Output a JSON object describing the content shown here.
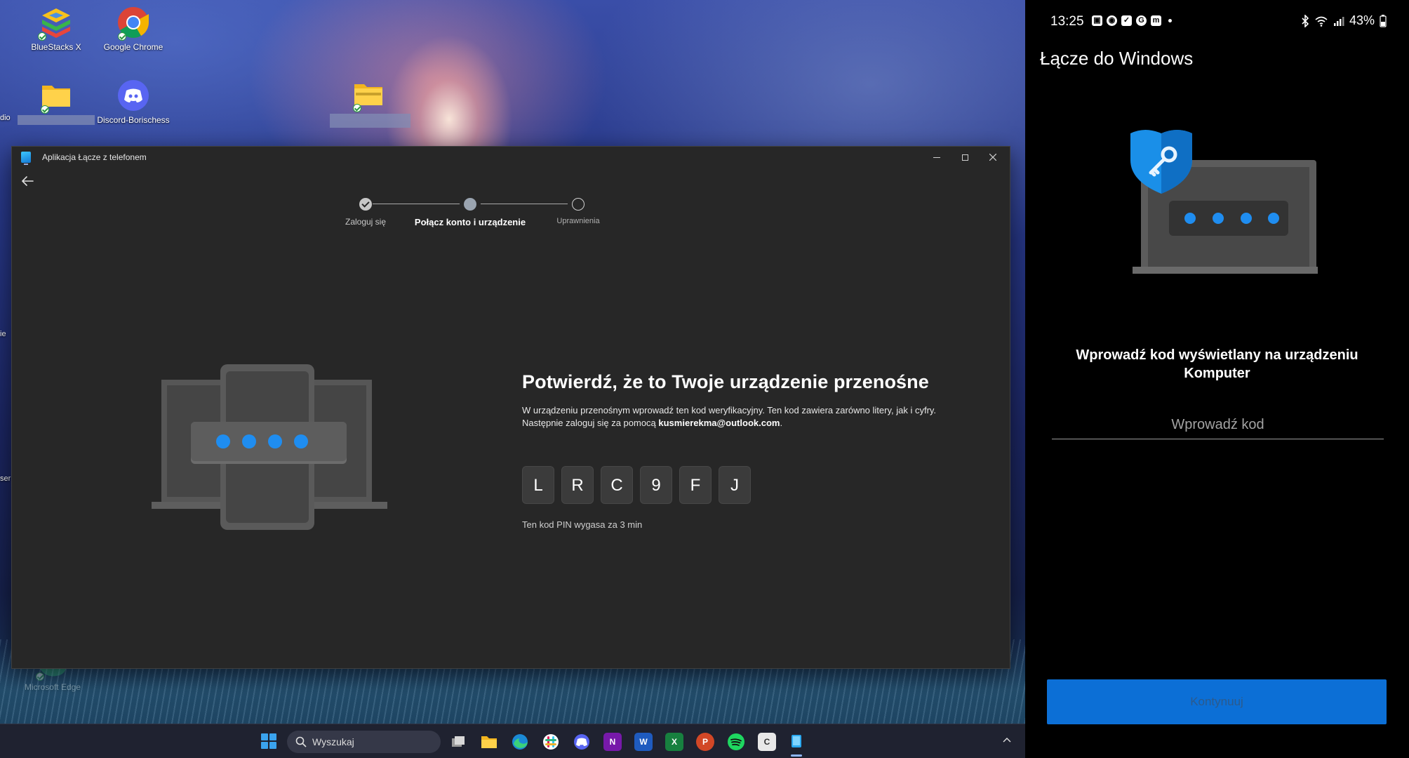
{
  "desktop": {
    "icons": [
      {
        "label": "BlueStacks X"
      },
      {
        "label": "Google Chrome"
      },
      {
        "label": "Discord-Borischess"
      },
      {
        "label": "Microsoft Edge"
      }
    ],
    "left_cut_labels": [
      "dio",
      "ie",
      "ser"
    ]
  },
  "app": {
    "title": "Aplikacja Łącze z telefonem",
    "steps": [
      {
        "label": "Zaloguj się",
        "state": "done"
      },
      {
        "label": "Połącz konto i urządzenie",
        "state": "current"
      },
      {
        "label": "Uprawnienia",
        "state": "todo"
      }
    ],
    "heading": "Potwierdź, że to Twoje urządzenie przenośne",
    "description_part1": "W urządzeniu przenośnym wprowadź ten kod weryfikacyjny. Ten kod zawiera zarówno litery, jak i cyfry. Następnie zaloguj się za pomocą ",
    "email": "kusmierekma@outlook.com",
    "description_end": ".",
    "code": [
      "L",
      "R",
      "C",
      "9",
      "F",
      "J"
    ],
    "pin_note": "Ten kod PIN wygasa za 3 min"
  },
  "taskbar": {
    "search_placeholder": "Wyszukaj",
    "apps": [
      "task-view",
      "file-explorer",
      "edge",
      "slack",
      "discord",
      "onenote",
      "word",
      "excel",
      "powerpoint",
      "spotify",
      "clipboard",
      "phone-link"
    ]
  },
  "phone": {
    "time": "13:25",
    "battery": "43%",
    "app_title": "Łącze do Windows",
    "instruction": "Wprowadź kod wyświetlany na urządzeniu Komputer",
    "code_placeholder": "Wprowadź kod",
    "code_value": "",
    "continue_label": "Kontynuuj"
  },
  "colors": {
    "accent_blue": "#0c6fd6",
    "dot_blue": "#1f8df0",
    "window_bg": "#272727"
  }
}
